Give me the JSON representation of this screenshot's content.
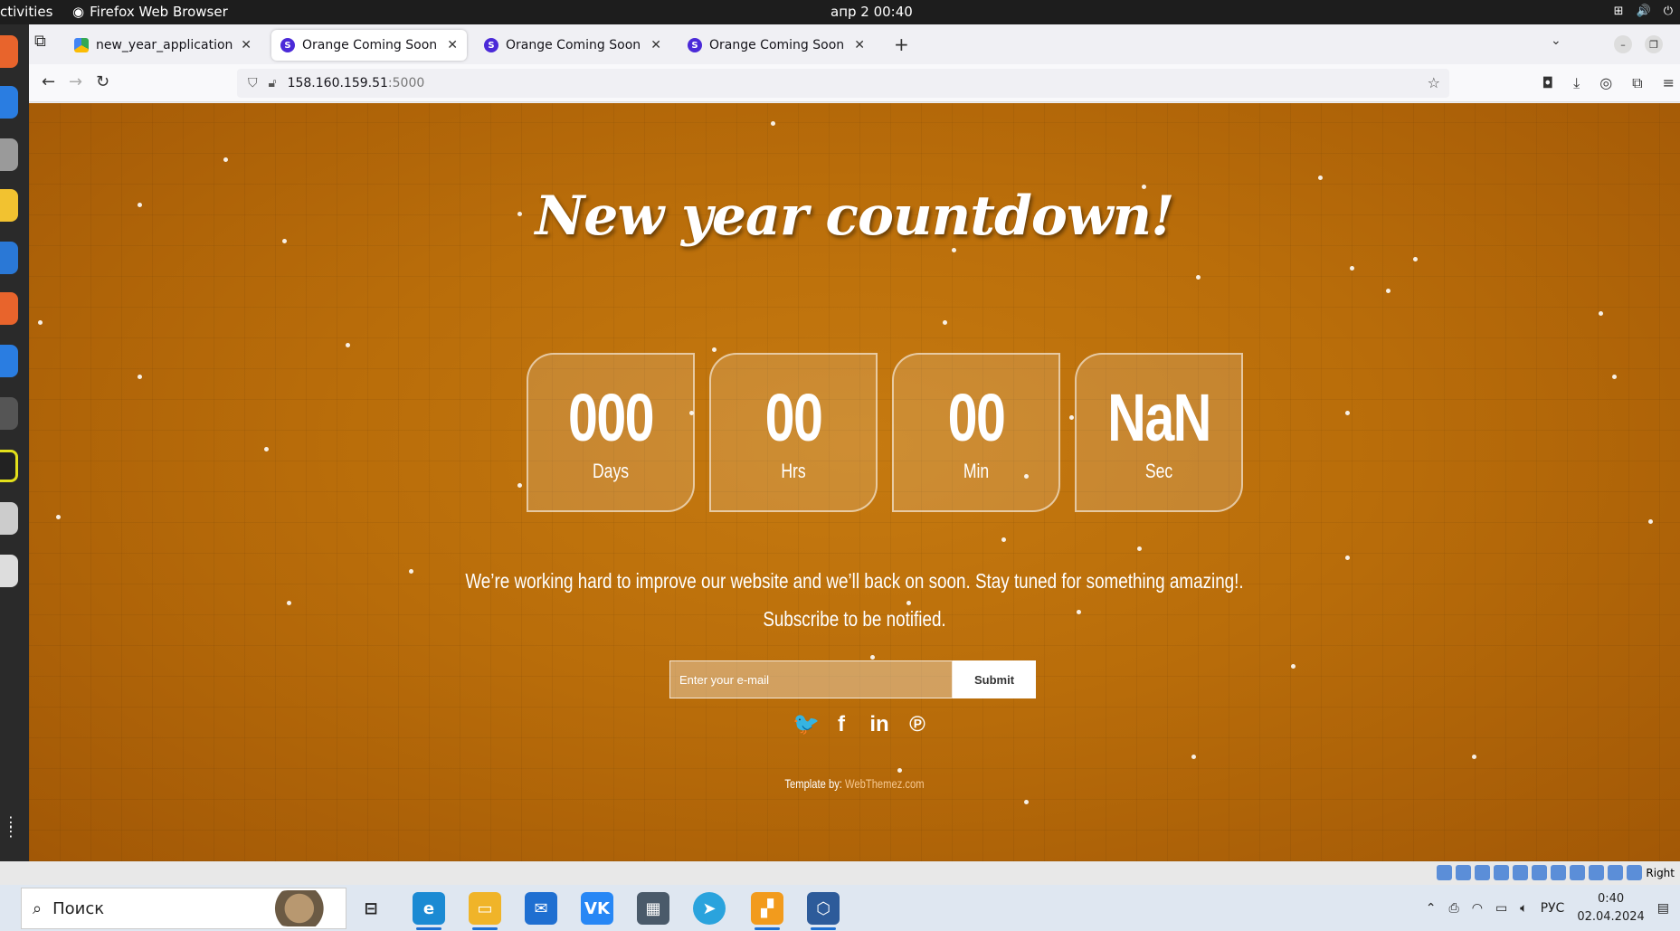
{
  "os_topbar": {
    "activities": "ctivities",
    "app_name": "Firefox Web Browser",
    "clock": "апр 2  00:40"
  },
  "browser": {
    "tabs": [
      {
        "title": "new_year_application – G",
        "favicon": "google-drive-icon",
        "active": false
      },
      {
        "title": "Orange Coming Soon HTML",
        "favicon": "s-favicon-icon",
        "active": true
      },
      {
        "title": "Orange Coming Soon HTML",
        "favicon": "s-favicon-icon",
        "active": false
      },
      {
        "title": "Orange Coming Soon HTML",
        "favicon": "s-favicon-icon",
        "active": false
      }
    ],
    "url_host": "158.160.159.51",
    "url_port": ":5000"
  },
  "page": {
    "title": "New year countdown!",
    "counters": [
      {
        "value": "000",
        "unit": "Days"
      },
      {
        "value": "00",
        "unit": "Hrs"
      },
      {
        "value": "00",
        "unit": "Min"
      },
      {
        "value": "NaN",
        "unit": "Sec"
      }
    ],
    "message_line1": "We’re working hard to improve our website and we’ll back on soon. Stay tuned for something amazing!.",
    "message_line2": "Subscribe to be notified.",
    "email_placeholder": "Enter your e-mail",
    "submit_label": "Submit",
    "social": [
      {
        "name": "twitter-icon",
        "glyph": "🐦"
      },
      {
        "name": "facebook-icon",
        "glyph": "f"
      },
      {
        "name": "linkedin-icon",
        "glyph": "in"
      },
      {
        "name": "pinterest-icon",
        "glyph": "℗"
      }
    ],
    "credit_prefix": "Template by:",
    "credit_link": "WebThemez.com",
    "background_color": "#b96d0a"
  },
  "vbox_strip": {
    "right_label": "Right"
  },
  "taskbar": {
    "search_placeholder": "Поиск",
    "lang": "РУС",
    "time": "0:40",
    "date": "02.04.2024"
  }
}
